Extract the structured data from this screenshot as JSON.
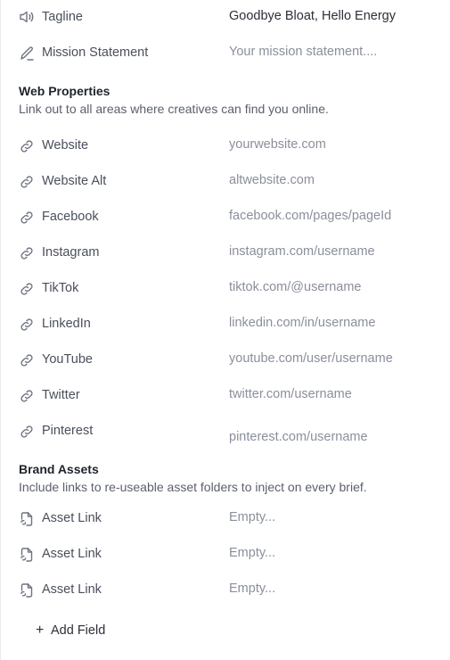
{
  "brand_info": {
    "tagline": {
      "label": "Tagline",
      "value": "Goodbye Bloat, Hello Energy",
      "icon": "speaker-icon"
    },
    "mission": {
      "label": "Mission Statement",
      "placeholder": "Your mission statement....",
      "icon": "pen-icon"
    }
  },
  "web_properties": {
    "title": "Web Properties",
    "description": "Link out to all areas where creatives can find you online.",
    "items": [
      {
        "label": "Website",
        "placeholder": "yourwebsite.com",
        "icon": "link-icon"
      },
      {
        "label": "Website Alt",
        "placeholder": "altwebsite.com",
        "icon": "link-icon"
      },
      {
        "label": "Facebook",
        "placeholder": "facebook.com/pages/pageId",
        "icon": "link-icon"
      },
      {
        "label": "Instagram",
        "placeholder": "instagram.com/username",
        "icon": "link-icon"
      },
      {
        "label": "TikTok",
        "placeholder": "tiktok.com/@username",
        "icon": "link-icon"
      },
      {
        "label": "LinkedIn",
        "placeholder": "linkedin.com/in/username",
        "icon": "link-icon"
      },
      {
        "label": "YouTube",
        "placeholder": "youtube.com/user/username",
        "icon": "link-icon"
      },
      {
        "label": "Twitter",
        "placeholder": "twitter.com/username",
        "icon": "link-icon"
      },
      {
        "label": "Pinterest",
        "placeholder": "pinterest.com/username",
        "icon": "link-icon"
      }
    ]
  },
  "brand_assets": {
    "title": "Brand Assets",
    "description": "Include links to re-useable asset folders to inject on every brief.",
    "items": [
      {
        "label": "Asset Link",
        "placeholder": "Empty...",
        "icon": "file-link-icon"
      },
      {
        "label": "Asset Link",
        "placeholder": "Empty...",
        "icon": "file-link-icon"
      },
      {
        "label": "Asset Link",
        "placeholder": "Empty...",
        "icon": "file-link-icon"
      }
    ],
    "add_field_label": "Add Field",
    "add_field_icon": "plus-icon"
  }
}
